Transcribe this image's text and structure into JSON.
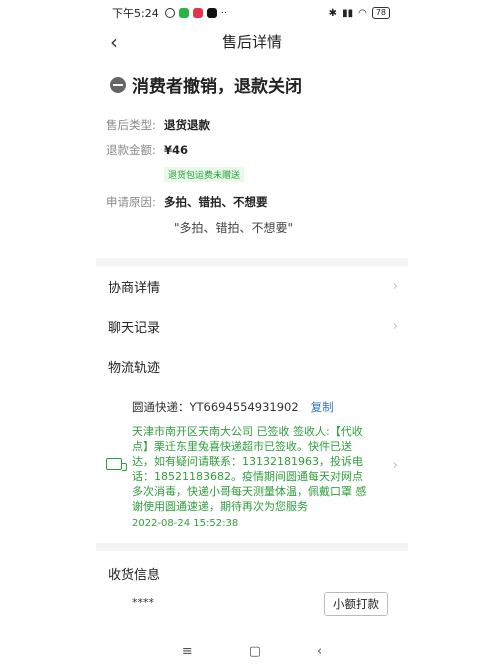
{
  "status_bar": {
    "time": "下午5:24",
    "battery": "78",
    "left_icons": [
      "alarm-icon",
      "phone-app-icon",
      "red-app-icon",
      "tiktok-icon",
      "more-dots-icon"
    ],
    "more": "··"
  },
  "nav": {
    "back": "‹",
    "title": "售后详情"
  },
  "status_title": "消费者撤销，退款关闭",
  "info": {
    "type_label": "售后类型:",
    "type_value": "退货退款",
    "amount_label": "退款金额:",
    "amount_value": "¥46",
    "tag": "退货包运费未赠送",
    "reason_label": "申请原因:",
    "reason_value": "多拍、错拍、不想要",
    "reason_quote": "\"多拍、错拍、不想要\""
  },
  "list": {
    "negotiation": "协商详情",
    "chat": "聊天记录",
    "logistics": "物流轨迹",
    "chevron": "›"
  },
  "logistics": {
    "tracking_prefix": "圆通快递：",
    "tracking_number": "YT6694554931902",
    "copy": "复制",
    "text": "天津市南开区天南大公司 已签收 签收人:【代收点】栗迁东里兔喜快递超市已签收。快件已送达，如有疑问请联系：13132181963，投诉电话：18521183682。疫情期间圆通每天对网点多次消毒，快递小哥每天测量体温，佩戴口罩 感谢使用圆通速递，期待再次为您服务",
    "time": "2022-08-24 15:52:38"
  },
  "receive": {
    "title": "收货信息",
    "masked": "****"
  },
  "action_button": "小额打款",
  "android_nav": {
    "menu": "≡",
    "home": "▢",
    "back": "‹"
  },
  "colors": {
    "green": "#2f9e3d",
    "link": "#2f74c8",
    "tag_bg": "#eaf8ea"
  }
}
